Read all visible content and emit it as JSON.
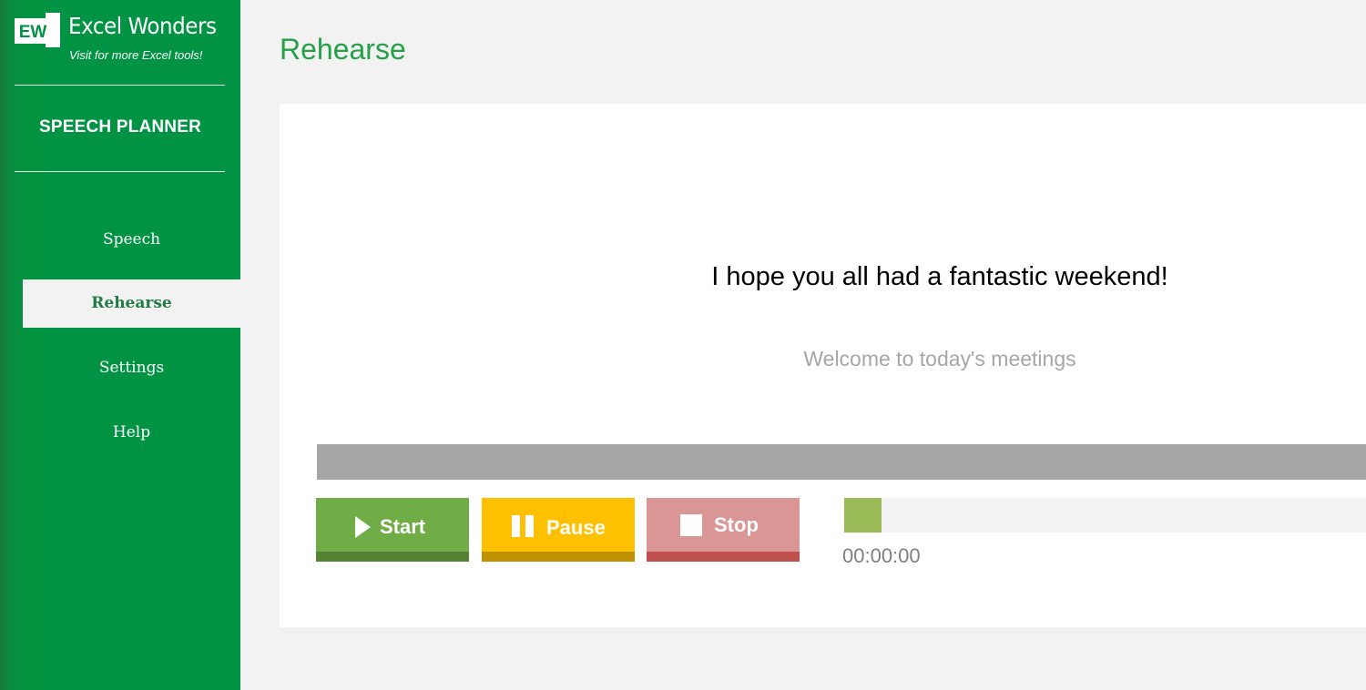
{
  "brand": {
    "badge_text": "EW",
    "name": "Excel Wonders",
    "tagline": "Visit for more Excel tools!"
  },
  "sidebar": {
    "app_title": "SPEECH PLANNER",
    "items": [
      {
        "label": "Speech",
        "active": false
      },
      {
        "label": "Rehearse",
        "active": true
      },
      {
        "label": "Settings",
        "active": false
      },
      {
        "label": "Help",
        "active": false
      }
    ]
  },
  "main": {
    "title": "Rehearse",
    "current_line": "I hope you all had a fantastic weekend!",
    "next_line": "Welcome to today's meetings",
    "controls": {
      "start_label": "Start",
      "pause_label": "Pause",
      "stop_label": "Stop"
    },
    "progress_fraction": 0.06,
    "timer": "00:00:00"
  },
  "colors": {
    "brand_green": "#009343",
    "title_green": "#24a049",
    "start": "#70ad47",
    "pause": "#ffc000",
    "stop": "#da9694",
    "progress": "#9bbb59"
  }
}
